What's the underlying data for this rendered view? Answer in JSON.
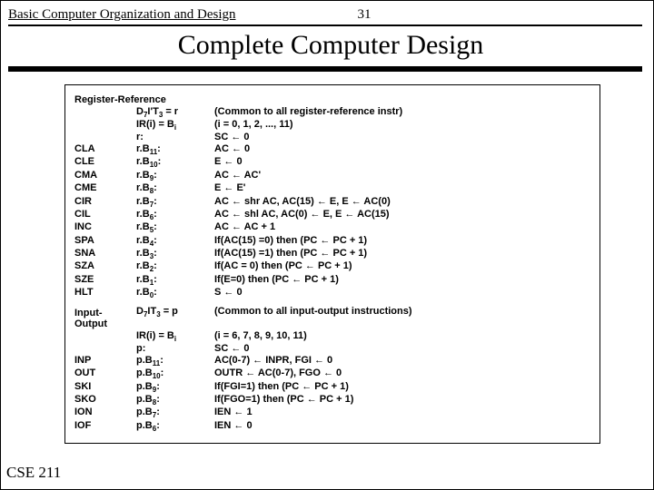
{
  "header": {
    "course": "Basic Computer Organization and Design",
    "page_no": "31",
    "title": "Complete Computer Design"
  },
  "footer": {
    "label": "CSE 211"
  },
  "regref": {
    "heading": "Register-Reference",
    "pre": [
      {
        "a": "",
        "b": "D7I'T3 = r",
        "c": "(Common to all register-reference instr)"
      },
      {
        "a": "",
        "b": "IR(i) = Bi",
        "c": "(i = 0, 1, 2, ..., 11)"
      },
      {
        "a": "",
        "b": "r:",
        "c": "SC ← 0"
      }
    ],
    "rows": [
      {
        "a": "CLA",
        "b": "r.B11:",
        "c": "AC ← 0"
      },
      {
        "a": "CLE",
        "b": "r.B10:",
        "c": "E ← 0"
      },
      {
        "a": "CMA",
        "b": "r.B9:",
        "c": "AC ← AC'"
      },
      {
        "a": "CME",
        "b": "r.B8:",
        "c": "E ← E'"
      },
      {
        "a": "CIR",
        "b": "r.B7:",
        "c": "AC ← shr AC, AC(15) ← E, E ← AC(0)"
      },
      {
        "a": "CIL",
        "b": "r.B6:",
        "c": "AC ← shl AC, AC(0) ← E, E ← AC(15)"
      },
      {
        "a": "INC",
        "b": "r.B5:",
        "c": "AC ← AC + 1"
      },
      {
        "a": "SPA",
        "b": "r.B4:",
        "c": "If(AC(15) =0) then  (PC ← PC + 1)"
      },
      {
        "a": "SNA",
        "b": "r.B3:",
        "c": "If(AC(15) =1) then  (PC ← PC + 1)"
      },
      {
        "a": "SZA",
        "b": "r.B2:",
        "c": "If(AC = 0) then (PC ← PC + 1)"
      },
      {
        "a": "SZE",
        "b": "r.B1:",
        "c": "If(E=0) then (PC ← PC + 1)"
      },
      {
        "a": "HLT",
        "b": "r.B0:",
        "c": "S ← 0"
      }
    ]
  },
  "io": {
    "heading": "Input-Output",
    "pre": [
      {
        "a": "",
        "b": "D7IT3 = p",
        "c": "(Common to all input-output instructions)"
      },
      {
        "a": "",
        "b": "IR(i) = Bi",
        "c": "(i = 6, 7, 8, 9, 10, 11)"
      },
      {
        "a": "",
        "b": "p:",
        "c": "SC ← 0"
      }
    ],
    "rows": [
      {
        "a": "INP",
        "b": "p.B11:",
        "c": "AC(0-7) ← INPR, FGI ← 0"
      },
      {
        "a": "OUT",
        "b": "p.B10:",
        "c": "OUTR ← AC(0-7), FGO ← 0"
      },
      {
        "a": "SKI",
        "b": "p.B9:",
        "c": "If(FGI=1) then (PC ← PC + 1)"
      },
      {
        "a": "SKO",
        "b": "p.B8:",
        "c": "If(FGO=1) then (PC ← PC + 1)"
      },
      {
        "a": "ION",
        "b": "p.B7:",
        "c": "IEN ← 1"
      },
      {
        "a": "IOF",
        "b": "p.B6:",
        "c": "IEN ← 0"
      }
    ]
  }
}
